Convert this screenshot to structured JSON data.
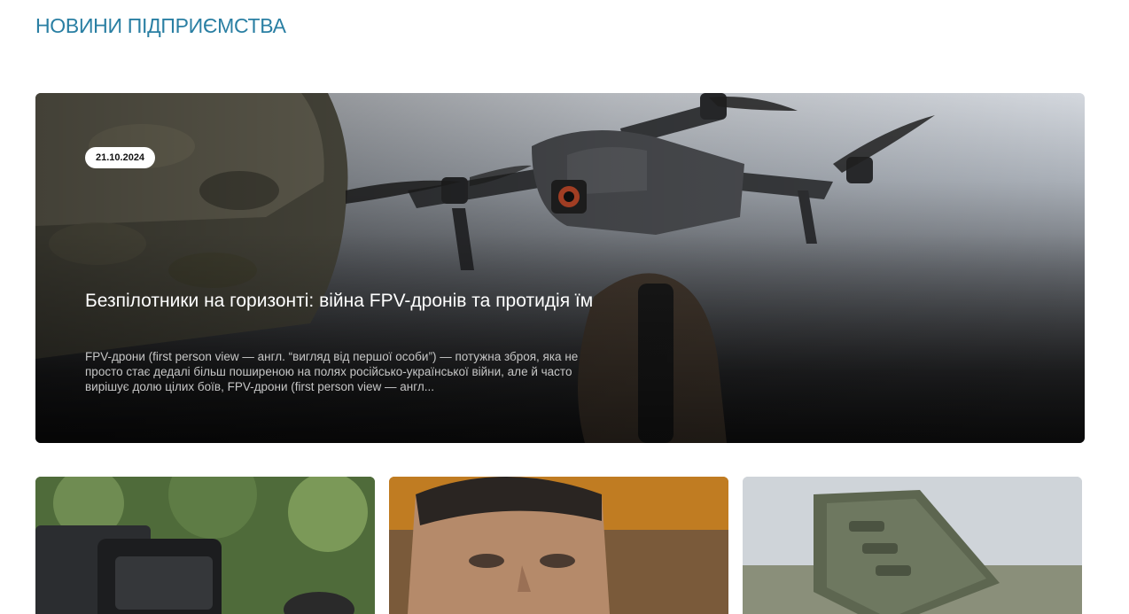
{
  "section": {
    "title": "НОВИНИ ПІДПРИЄМСТВА"
  },
  "featured": {
    "date": "21.10.2024",
    "title": "Безпілотники на горизонті: війна FPV-дронів та протидія їм",
    "excerpt": "FPV-дрони (first person view — англ. “вигляд від першої особи”) — потужна зброя, яка не просто стає дедалі більш поширеною на полях російсько-української війни, але й часто вирішує долю цілих боїв, FPV-дрони (first person view — англ...",
    "image_icon": "drone-photo"
  },
  "cards": [
    {
      "image_icon": "military-equipment-photo"
    },
    {
      "image_icon": "person-portrait-photo"
    },
    {
      "image_icon": "antenna-device-photo"
    }
  ],
  "colors": {
    "heading": "#2a7fa3",
    "badge_bg": "#ffffff",
    "title_text": "#ffffff",
    "excerpt_text": "#c6c6c6"
  }
}
